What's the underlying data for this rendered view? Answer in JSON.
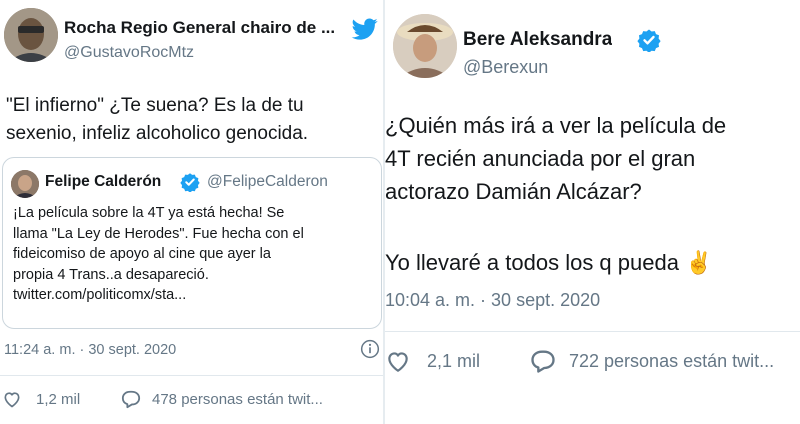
{
  "colors": {
    "verified": "#1da1f2",
    "twitter_blue": "#1da1f2",
    "secondary_text": "#657786"
  },
  "left_tweet": {
    "author_name": "Rocha Regio General chairo de ...",
    "author_handle": "@GustavoRocMtz",
    "body": "\"El infierno\" ¿Te suena? Es la de tu\nsexenio, infeliz alcoholico genocida.",
    "quoted": {
      "author_name": "Felipe Calderón",
      "author_handle": "@FelipeCalderon",
      "verified": true,
      "body": "¡La película sobre la 4T ya está hecha! Se\nllama \"La Ley de Herodes\".  Fue hecha con el\nfideicomiso de apoyo al cine que ayer la\npropia 4 Trans..a desapareció.\ntwitter.com/politicomx/sta..."
    },
    "timestamp": "11:24 a. m. · 30 sept. 2020",
    "likes": "1,2 mil",
    "talking": "478 personas están twit..."
  },
  "right_tweet": {
    "author_name": "Bere Aleksandra",
    "author_handle": "@Berexun",
    "verified": true,
    "body": "¿Quién más irá a ver la película de\n4T recién anunciada por el gran\nactorazo Damián Alcázar?",
    "body_line2": "Yo llevaré a todos los q pueda ✌",
    "timestamp": "10:04 a. m. · 30 sept. 2020",
    "likes": "2,1 mil",
    "talking": "722 personas están twit..."
  }
}
